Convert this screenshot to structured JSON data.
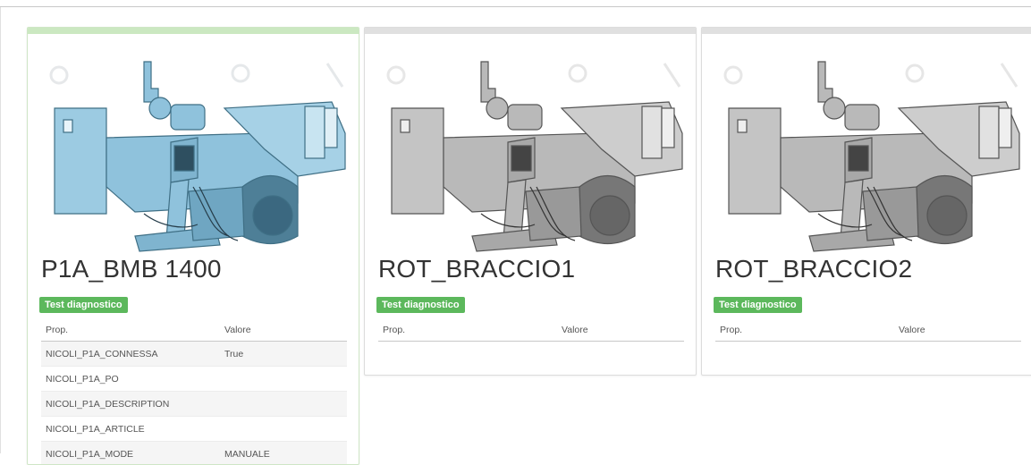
{
  "cards": [
    {
      "title": "P1A_BMB 1400",
      "status_color": "#cbe8c1",
      "image_tint": "blue",
      "badge": "Test diagnostico",
      "columns": [
        "Prop.",
        "Valore"
      ],
      "rows": [
        [
          "NICOLI_P1A_CONNESSA",
          "True"
        ],
        [
          "NICOLI_P1A_PO",
          ""
        ],
        [
          "NICOLI_P1A_DESCRIPTION",
          ""
        ],
        [
          "NICOLI_P1A_ARTICLE",
          ""
        ],
        [
          "NICOLI_P1A_MODE",
          "MANUALE"
        ]
      ]
    },
    {
      "title": "ROT_BRACCIO1",
      "status_color": "#e0e0e0",
      "image_tint": "gray",
      "badge": "Test diagnostico",
      "columns": [
        "Prop.",
        "Valore"
      ],
      "rows": []
    },
    {
      "title": "ROT_BRACCIO2",
      "status_color": "#e0e0e0",
      "image_tint": "gray",
      "badge": "Test diagnostico",
      "columns": [
        "Prop.",
        "Valore"
      ],
      "rows": []
    }
  ],
  "colors": {
    "badge": "#5cb85c",
    "active": "#cbe8c1",
    "inactive": "#e0e0e0"
  }
}
